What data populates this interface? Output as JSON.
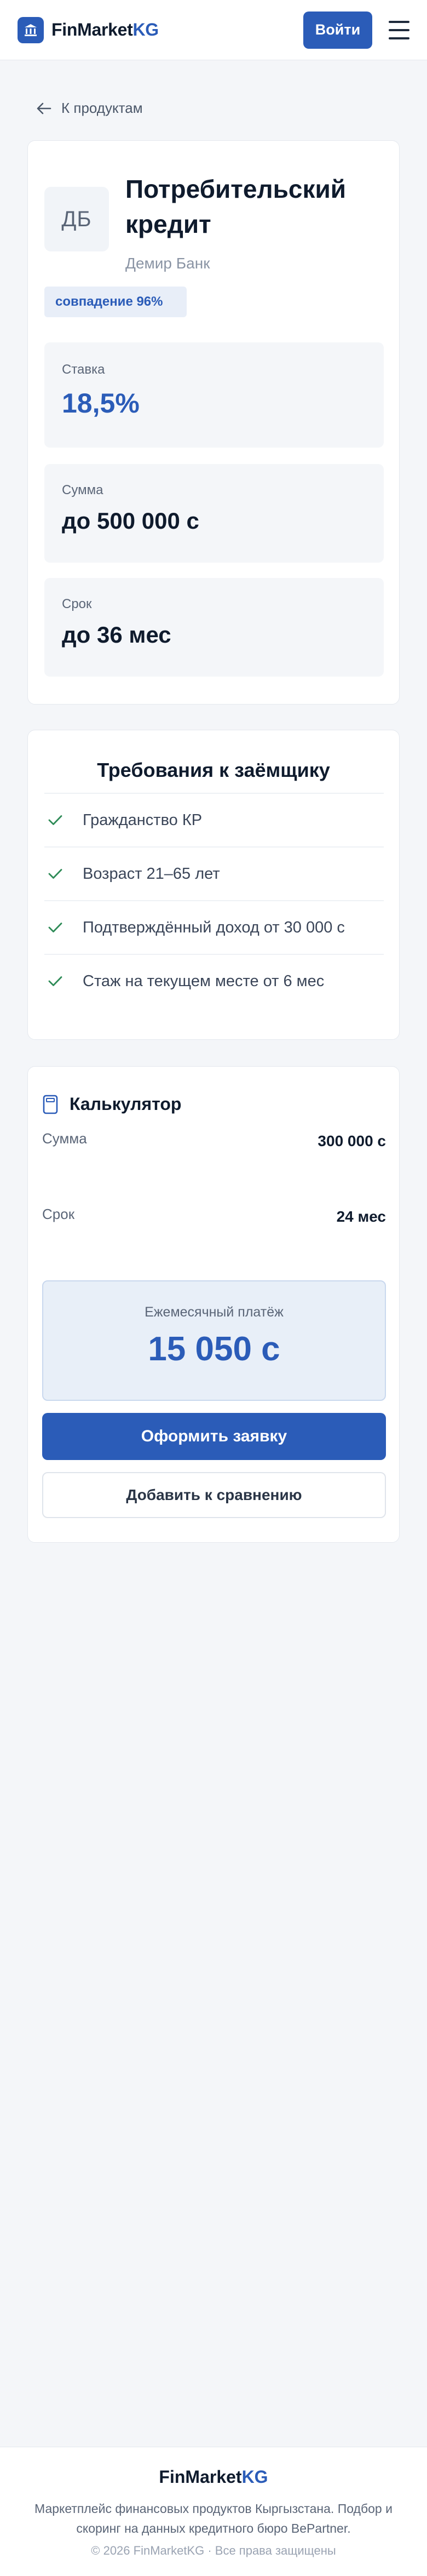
{
  "header": {
    "logo_main": "FinMarket",
    "logo_accent": "KG",
    "login_label": "Войти"
  },
  "back_label": "К продуктам",
  "product": {
    "bank_initials": "ДБ",
    "title": "Потребительский кредит",
    "bank_name": "Демир Банк",
    "match_badge": "совпадение 96%",
    "rate_label": "Ставка",
    "rate_value": "18,5%",
    "sum_label": "Сумма",
    "sum_value": "до 500 000 с",
    "term_label": "Срок",
    "term_value": "до 36 мес"
  },
  "requirements": {
    "title": "Требования к заёмщику",
    "items": [
      "Гражданство КР",
      "Возраст 21–65 лет",
      "Подтверждённый доход от 30 000 с",
      "Стаж на текущем месте от 6 мес"
    ]
  },
  "calculator": {
    "title": "Калькулятор",
    "sum_label": "Сумма",
    "sum_value": "300 000 с",
    "term_label": "Срок",
    "term_value": "24 мес",
    "payment_label": "Ежемесячный платёж",
    "payment_value": "15 050 с",
    "apply_label": "Оформить заявку",
    "compare_label": "Добавить к сравнению"
  },
  "footer": {
    "logo_main": "FinMarket",
    "logo_accent": "KG",
    "description": "Маркетплейс финансовых продуктов Кыргызстана. Подбор и скоринг на данных кредитного бюро BePartner.",
    "copyright": "© 2026 FinMarketKG · Все права защищены"
  },
  "colors": {
    "accent": "#2b5cb8",
    "check": "#2e8b57",
    "background": "#f4f6f9"
  },
  "icons": {
    "logo": "bank-building-icon",
    "menu": "hamburger-menu-icon",
    "back": "arrow-left-icon",
    "requirement": "check-icon",
    "calculator": "calculator-icon"
  }
}
